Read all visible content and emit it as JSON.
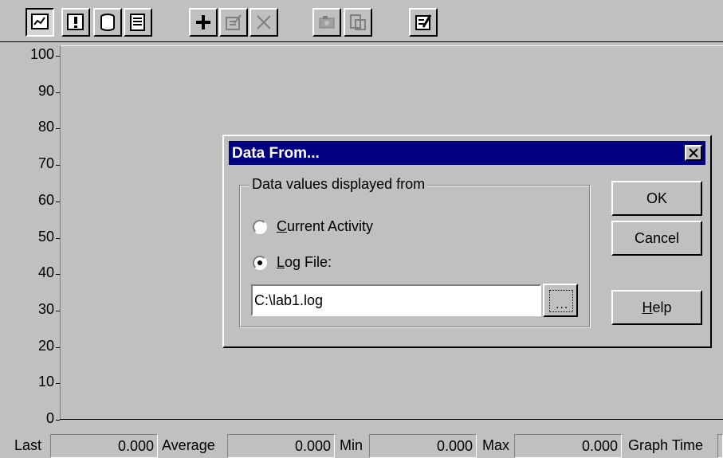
{
  "toolbar": {
    "buttons": [
      {
        "name": "chart-view-icon",
        "pressed": true
      },
      {
        "name": "alert-view-icon",
        "pressed": false
      },
      {
        "name": "log-view-icon",
        "pressed": false
      },
      {
        "name": "report-view-icon",
        "pressed": false
      },
      {
        "name": "add-counter-icon",
        "pressed": false
      },
      {
        "name": "edit-counter-icon",
        "pressed": false
      },
      {
        "name": "delete-counter-icon",
        "pressed": false
      },
      {
        "name": "snapshot-icon",
        "pressed": false
      },
      {
        "name": "export-icon",
        "pressed": false
      },
      {
        "name": "options-icon",
        "pressed": false
      }
    ]
  },
  "graph": {
    "y_ticks": [
      "100",
      "90",
      "80",
      "70",
      "60",
      "50",
      "40",
      "30",
      "20",
      "10",
      "0"
    ]
  },
  "status": {
    "last_label": "Last",
    "last_value": "0.000",
    "average_label": "Average",
    "average_value": "0.000",
    "min_label": "Min",
    "min_value": "0.000",
    "max_label": "Max",
    "max_value": "0.000",
    "graph_time_label": "Graph Time"
  },
  "dialog": {
    "title": "Data From...",
    "group_label": "Data values displayed from",
    "option_current_prefix": "C",
    "option_current_rest": "urrent Activity",
    "option_current_checked": false,
    "option_log_prefix": "L",
    "option_log_rest": "og File:",
    "option_log_checked": true,
    "log_file_value": "C:\\lab1.log",
    "browse_label": "...",
    "ok_label": "OK",
    "cancel_label": "Cancel",
    "help_prefix": "H",
    "help_rest": "elp"
  }
}
